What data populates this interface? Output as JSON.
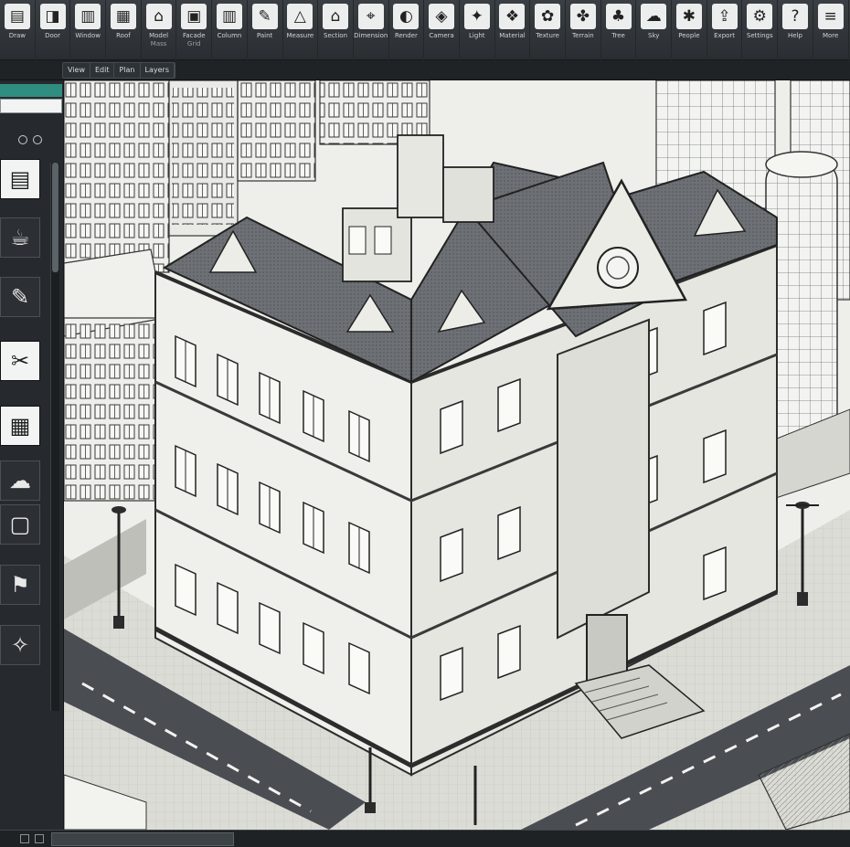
{
  "ribbon": {
    "tools": [
      {
        "name": "wall",
        "label": "Draw",
        "label2": "",
        "glyph": "▤"
      },
      {
        "name": "door",
        "label": "Door",
        "label2": "",
        "glyph": "◨"
      },
      {
        "name": "window",
        "label": "Window",
        "label2": "",
        "glyph": "▥"
      },
      {
        "name": "roof",
        "label": "Roof",
        "label2": "",
        "glyph": "▦"
      },
      {
        "name": "building",
        "label": "Model",
        "label2": "Mass",
        "glyph": "⌂"
      },
      {
        "name": "facade",
        "label": "Facade",
        "label2": "Grid",
        "glyph": "▣"
      },
      {
        "name": "column",
        "label": "Column",
        "label2": "",
        "glyph": "▥"
      },
      {
        "name": "brush",
        "label": "Paint",
        "label2": "",
        "glyph": "✎"
      },
      {
        "name": "measure",
        "label": "Measure",
        "label2": "",
        "glyph": "△"
      },
      {
        "name": "section",
        "label": "Section",
        "label2": "",
        "glyph": "⌂"
      },
      {
        "name": "dimension",
        "label": "Dimension",
        "label2": "",
        "glyph": "⌖"
      },
      {
        "name": "render",
        "label": "Render",
        "label2": "",
        "glyph": "◐"
      },
      {
        "name": "camera",
        "label": "Camera",
        "label2": "",
        "glyph": "◈"
      },
      {
        "name": "light",
        "label": "Light",
        "label2": "",
        "glyph": "✦"
      },
      {
        "name": "material",
        "label": "Material",
        "label2": "",
        "glyph": "❖"
      },
      {
        "name": "texture",
        "label": "Texture",
        "label2": "",
        "glyph": "✿"
      },
      {
        "name": "terrain",
        "label": "Terrain",
        "label2": "",
        "glyph": "✤"
      },
      {
        "name": "tree",
        "label": "Tree",
        "label2": "",
        "glyph": "♣"
      },
      {
        "name": "cloud",
        "label": "Sky",
        "label2": "",
        "glyph": "☁"
      },
      {
        "name": "figure",
        "label": "People",
        "label2": "",
        "glyph": "✱"
      },
      {
        "name": "export",
        "label": "Export",
        "label2": "",
        "glyph": "⇪"
      },
      {
        "name": "settings",
        "label": "Settings",
        "label2": "",
        "glyph": "⚙"
      },
      {
        "name": "help",
        "label": "Help",
        "label2": "",
        "glyph": "?"
      },
      {
        "name": "more",
        "label": "More",
        "label2": "",
        "glyph": "≡"
      }
    ]
  },
  "subbar": {
    "tabs": [
      "View",
      "Edit",
      "Plan",
      "Layers"
    ]
  },
  "left_panel": {
    "items": [
      {
        "glyph": "▤",
        "label": ""
      },
      {
        "glyph": "☕",
        "label": ""
      },
      {
        "glyph": "✎",
        "label": ""
      },
      {
        "glyph": "✂",
        "label": ""
      },
      {
        "glyph": "▦",
        "label": ""
      },
      {
        "glyph": "☁",
        "label": ""
      },
      {
        "glyph": "▢",
        "label": ""
      },
      {
        "glyph": "⚑",
        "label": ""
      },
      {
        "glyph": "✧",
        "label": ""
      }
    ]
  },
  "statusbar": {
    "left": "",
    "tab": ""
  },
  "colors": {
    "ribbon": "#3a3f44",
    "panel": "#262a2e",
    "accent": "#2f8e80",
    "sketch_bg": "#e8e8e4",
    "road": "#4a4d52"
  }
}
